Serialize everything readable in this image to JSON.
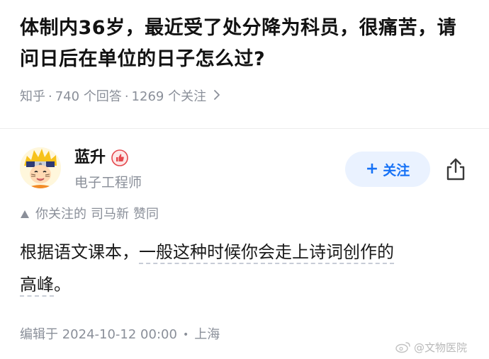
{
  "question": {
    "title": "体制内36岁，最近受了处分降为科员，很痛苦，请问日后在单位的日子怎么过?",
    "source": "知乎",
    "answers": "740 个回答",
    "followers": "1269 个关注",
    "separator": "·",
    "chevron_icon": "chevron-right-icon"
  },
  "author": {
    "name": "蓝升",
    "title": "电子工程师",
    "badge_icon": "thumbs-up-badge-icon",
    "avatar": "naruto-avatar"
  },
  "actions": {
    "follow_label": "关注",
    "follow_plus": "+",
    "share_icon": "share-icon"
  },
  "upvote_note": {
    "prefix": "你关注的",
    "user": "司马新",
    "action": "赞同"
  },
  "answer": {
    "text_part1": "根据语文课本，",
    "text_dotted": "一般这种时候你会走上诗词创作的",
    "text_part2_dotted": "高峰",
    "text_end": "。"
  },
  "footer": {
    "edit_label": "编辑于 2024-10-12 00:00",
    "location": "上海",
    "dot": "•"
  },
  "watermark": {
    "text": "@文物医院"
  },
  "colors": {
    "accent": "#1772f6",
    "follow_bg": "#eaf2ff",
    "muted": "#8a8f99",
    "badge_red": "#e5484d"
  }
}
